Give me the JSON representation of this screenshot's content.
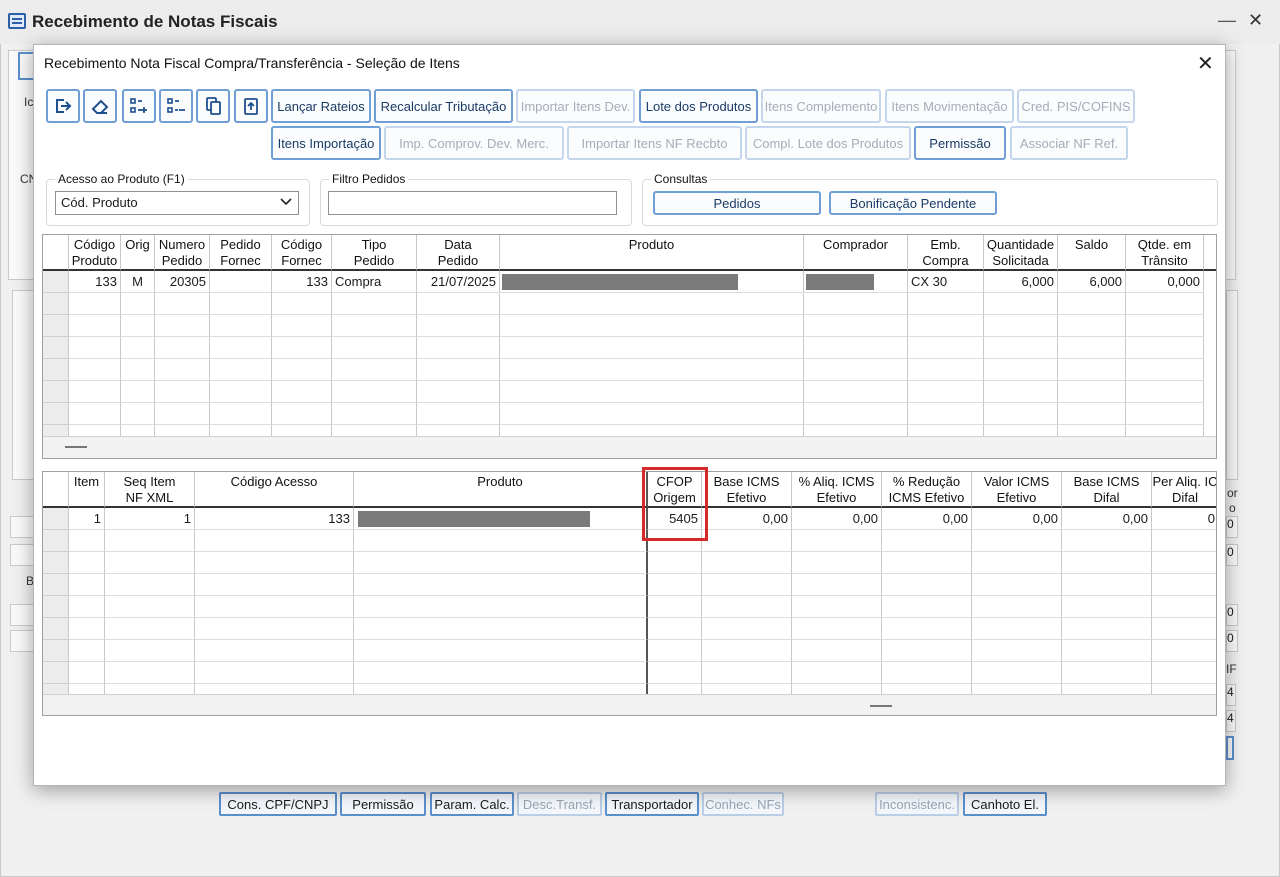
{
  "background": {
    "title": "Recebimento de Notas Fiscais",
    "partial_labels": [
      "Ic",
      "CN",
      "B",
      "or",
      "o",
      "0",
      "0",
      "0",
      "0",
      "IF",
      "4",
      "4"
    ],
    "bottom_buttons": [
      {
        "label": "Cons. CPF/CNPJ",
        "enabled": true
      },
      {
        "label": "Permissão",
        "enabled": true
      },
      {
        "label": "Param. Calc.",
        "enabled": true
      },
      {
        "label": "Desc.Transf.",
        "enabled": false
      },
      {
        "label": "Transportador",
        "enabled": true
      },
      {
        "label": "Conhec. NFs",
        "enabled": false
      },
      {
        "label": "Inconsistenc.",
        "enabled": false
      },
      {
        "label": "Canhoto El.",
        "enabled": true
      }
    ]
  },
  "modal": {
    "title": "Recebimento Nota Fiscal Compra/Transferência - Seleção de Itens",
    "icon_buttons": [
      "exit-icon",
      "eraser-icon",
      "add-list-icon",
      "remove-list-icon",
      "copy-icon",
      "paste-icon"
    ],
    "toolbar_row1": [
      {
        "label": "Lançar Rateios",
        "enabled": true
      },
      {
        "label": "Recalcular Tributação",
        "enabled": true
      },
      {
        "label": "Importar Itens Dev.",
        "enabled": false
      },
      {
        "label": "Lote dos Produtos",
        "enabled": true
      },
      {
        "label": "Itens Complemento",
        "enabled": false
      },
      {
        "label": "Itens Movimentação",
        "enabled": false
      },
      {
        "label": "Cred. PIS/COFINS",
        "enabled": false
      }
    ],
    "toolbar_row2": [
      {
        "label": "Itens Importação",
        "enabled": true
      },
      {
        "label": "Imp. Comprov. Dev. Merc.",
        "enabled": false
      },
      {
        "label": "Importar Itens NF Recbto",
        "enabled": false
      },
      {
        "label": "Compl. Lote dos Produtos",
        "enabled": false
      },
      {
        "label": "Permissão",
        "enabled": true
      },
      {
        "label": "Associar NF Ref.",
        "enabled": false
      }
    ],
    "acesso": {
      "label": "Acesso ao Produto (F1)",
      "value": "Cód. Produto"
    },
    "filtro": {
      "label": "Filtro Pedidos",
      "value": ""
    },
    "consultas": {
      "label": "Consultas",
      "buttons": [
        "Pedidos",
        "Bonificação Pendente"
      ]
    },
    "orders_grid": {
      "headers": [
        [
          "Código",
          "Produto"
        ],
        [
          "Orig",
          ""
        ],
        [
          "Numero",
          "Pedido"
        ],
        [
          "Pedido",
          "Fornec"
        ],
        [
          "Código",
          "Fornec"
        ],
        [
          "Tipo",
          "Pedido"
        ],
        [
          "Data",
          "Pedido"
        ],
        [
          "Produto",
          ""
        ],
        [
          "Comprador",
          ""
        ],
        [
          "Emb.",
          "Compra"
        ],
        [
          "Quantidade",
          "Solicitada"
        ],
        [
          "Saldo",
          ""
        ],
        [
          "Qtde. em",
          "Trânsito"
        ]
      ],
      "rows": [
        [
          "133",
          "M",
          "20305",
          "",
          "133",
          "Compra",
          "21/07/2025",
          "",
          "",
          "CX  30",
          "6,000",
          "6,000",
          "0,000"
        ]
      ]
    },
    "items_grid": {
      "headers": [
        [
          "Item",
          ""
        ],
        [
          "Seq Item",
          "NF XML"
        ],
        [
          "Código Acesso",
          ""
        ],
        [
          "Produto",
          ""
        ],
        [
          "CFOP",
          "Origem"
        ],
        [
          "Base ICMS",
          "Efetivo"
        ],
        [
          "% Aliq. ICMS",
          "Efetivo"
        ],
        [
          "% Redução",
          "ICMS Efetivo"
        ],
        [
          "Valor ICMS",
          "Efetivo"
        ],
        [
          "Base ICMS",
          "Difal"
        ],
        [
          "Per Aliq. IC",
          "Difal"
        ]
      ],
      "rows": [
        [
          "1",
          "1",
          "133",
          "",
          "5405",
          "0,00",
          "0,00",
          "0,00",
          "0,00",
          "0,00",
          "0"
        ]
      ]
    }
  },
  "colors": {
    "button_border": "#6f9fd6",
    "highlight": "#d32b2b"
  }
}
